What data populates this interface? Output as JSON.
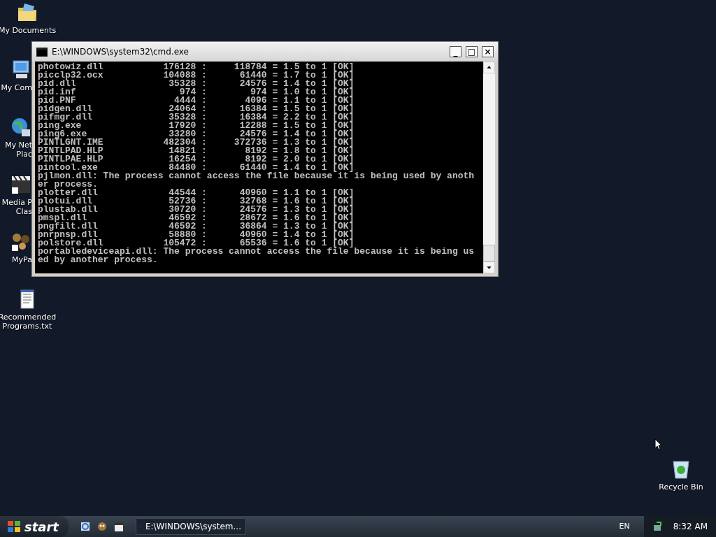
{
  "desktop_icons": [
    {
      "label": "My Documents",
      "kind": "folder",
      "covered": false
    },
    {
      "label": "My Com",
      "kind": "computer",
      "covered": true
    },
    {
      "label": "My Net\nPlac",
      "kind": "network",
      "covered": true
    },
    {
      "label": "Media P\nClas",
      "kind": "media",
      "covered": true
    },
    {
      "label": "MyPa",
      "kind": "game",
      "covered": true
    },
    {
      "label": "Recommended\nPrograms.txt",
      "kind": "text",
      "covered": false
    }
  ],
  "recycle_bin": {
    "label": "Recycle Bin"
  },
  "window": {
    "title": "E:\\WINDOWS\\system32\\cmd.exe",
    "buttons": [
      "_",
      "□",
      "×"
    ],
    "lines": [
      "photowiz.dll           176128 :     118784 = 1.5 to 1 [OK]",
      "picclp32.ocx           104088 :      61440 = 1.7 to 1 [OK]",
      "pid.dll                 35328 :      24576 = 1.4 to 1 [OK]",
      "pid.inf                   974 :        974 = 1.0 to 1 [OK]",
      "pid.PNF                  4444 :       4096 = 1.1 to 1 [OK]",
      "pidgen.dll              24064 :      16384 = 1.5 to 1 [OK]",
      "pifmgr.dll              35328 :      16384 = 2.2 to 1 [OK]",
      "ping.exe                17920 :      12288 = 1.5 to 1 [OK]",
      "ping6.exe               33280 :      24576 = 1.4 to 1 [OK]",
      "PINTLGNT.IME           482304 :     372736 = 1.3 to 1 [OK]",
      "PINTLPAD.HLP            14821 :       8192 = 1.8 to 1 [OK]",
      "PINTLPAE.HLP            16254 :       8192 = 2.0 to 1 [OK]",
      "pintool.exe             84480 :      61440 = 1.4 to 1 [OK]",
      "pjlmon.dll: The process cannot access the file because it is being used by anoth",
      "er process.",
      "plotter.dll             44544 :      40960 = 1.1 to 1 [OK]",
      "plotui.dll              52736 :      32768 = 1.6 to 1 [OK]",
      "plustab.dll             30720 :      24576 = 1.3 to 1 [OK]",
      "pmspl.dll               46592 :      28672 = 1.6 to 1 [OK]",
      "pngfilt.dll             46592 :      36864 = 1.3 to 1 [OK]",
      "pnrpnsp.dll             58880 :      40960 = 1.4 to 1 [OK]",
      "polstore.dll           105472 :      65536 = 1.6 to 1 [OK]",
      "portabledeviceapi.dll: The process cannot access the file because it is being us",
      "ed by another process."
    ]
  },
  "taskbar": {
    "start": "start",
    "quick_launch": [
      {
        "kind": "ie"
      },
      {
        "kind": "game"
      },
      {
        "kind": "media"
      }
    ],
    "tasks": [
      {
        "label": "E:\\WINDOWS\\system...",
        "selected": false
      }
    ],
    "language": "EN",
    "clock": "8:32 AM"
  }
}
